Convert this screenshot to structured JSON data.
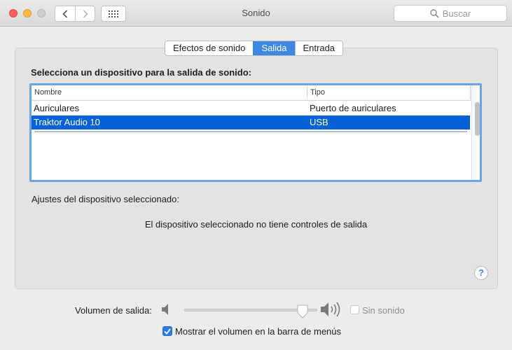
{
  "window": {
    "title": "Sonido",
    "search_placeholder": "Buscar"
  },
  "tabs": [
    {
      "label": "Efectos de sonido",
      "active": false
    },
    {
      "label": "Salida",
      "active": true
    },
    {
      "label": "Entrada",
      "active": false
    }
  ],
  "output": {
    "heading": "Selecciona un dispositivo para la salida de sonido:",
    "columns": {
      "name": "Nombre",
      "type": "Tipo"
    },
    "devices": [
      {
        "name": "Auriculares",
        "type": "Puerto de auriculares",
        "selected": false
      },
      {
        "name": "Traktor Audio 10",
        "type": "USB",
        "selected": true
      }
    ],
    "settings_label": "Ajustes del dispositivo seleccionado:",
    "no_controls_message": "El dispositivo seleccionado no tiene controles de salida"
  },
  "volume": {
    "label": "Volumen de salida:",
    "level_fraction": 0.92,
    "mute_label": "Sin sonido",
    "mute_checked": false,
    "show_in_menu_bar_label": "Mostrar el volumen en la barra de menús",
    "show_in_menu_bar_checked": true
  },
  "help": {
    "symbol": "?"
  },
  "icons": {
    "back": "chevron-left-icon",
    "forward": "chevron-right-icon",
    "show_all": "grid-icon",
    "search": "magnifier-icon",
    "volume_low": "speaker-low-icon",
    "volume_high": "speaker-high-icon",
    "checkmark": "checkmark-icon"
  },
  "colors": {
    "accent": "#3d88e0",
    "selection": "#0961d7"
  }
}
